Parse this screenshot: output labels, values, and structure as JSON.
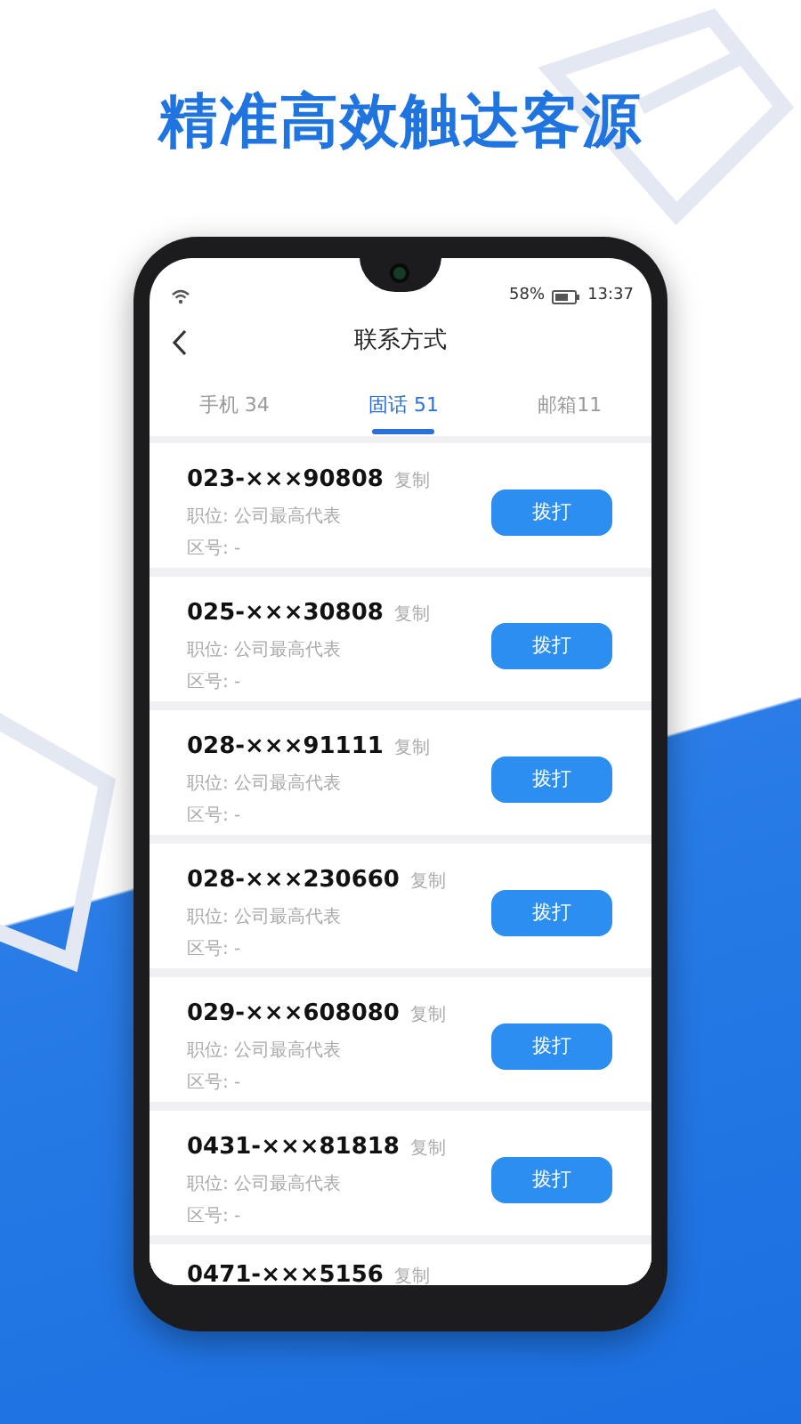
{
  "headline": "精准高效触达客源",
  "status_bar": {
    "battery": "58%",
    "time": "13:37"
  },
  "header": {
    "title": "联系方式"
  },
  "tabs": [
    {
      "label": "手机 34",
      "selected": false
    },
    {
      "label": "固话 51",
      "selected": true
    },
    {
      "label": "邮箱11",
      "selected": false
    }
  ],
  "contacts": [
    {
      "number": "023-×××90808",
      "copy": "复制",
      "position": "职位: 公司最高代表",
      "area": "区号: -",
      "button": "拨打"
    },
    {
      "number": "025-×××30808",
      "copy": "复制",
      "position": "职位: 公司最高代表",
      "area": "区号: -",
      "button": "拨打"
    },
    {
      "number": "028-×××91111",
      "copy": "复制",
      "position": "职位: 公司最高代表",
      "area": "区号: -",
      "button": "拨打"
    },
    {
      "number": "028-×××230660",
      "copy": "复制",
      "position": "职位: 公司最高代表",
      "area": "区号: -",
      "button": "拨打"
    },
    {
      "number": "029-×××608080",
      "copy": "复制",
      "position": "职位: 公司最高代表",
      "area": "区号: -",
      "button": "拨打"
    },
    {
      "number": "0431-×××81818",
      "copy": "复制",
      "position": "职位: 公司最高代表",
      "area": "区号: -",
      "button": "拨打"
    },
    {
      "number": "0471-×××5156",
      "copy": "复制"
    }
  ]
}
